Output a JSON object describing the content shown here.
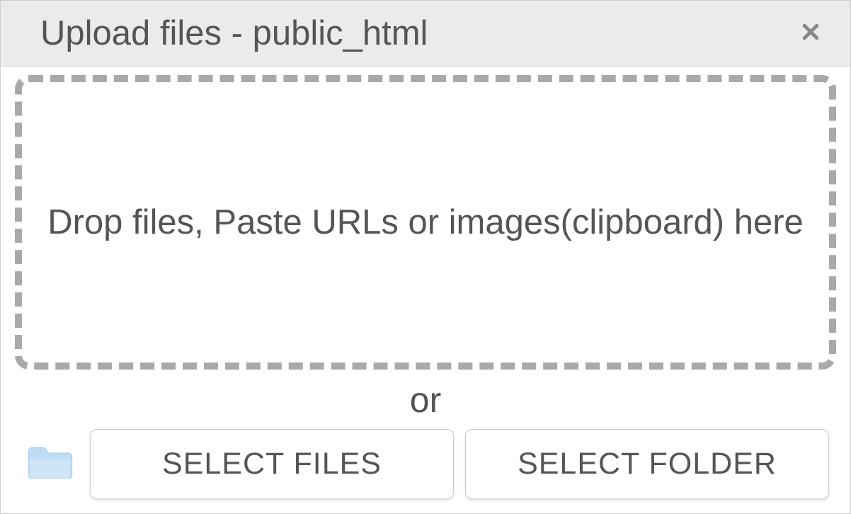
{
  "dialog": {
    "title": "Upload files - public_html"
  },
  "dropzone": {
    "text": "Drop files, Paste URLs or images(clipboard) here"
  },
  "separator": {
    "label": "or"
  },
  "buttons": {
    "select_files": "SELECT FILES",
    "select_folder": "SELECT FOLDER"
  }
}
